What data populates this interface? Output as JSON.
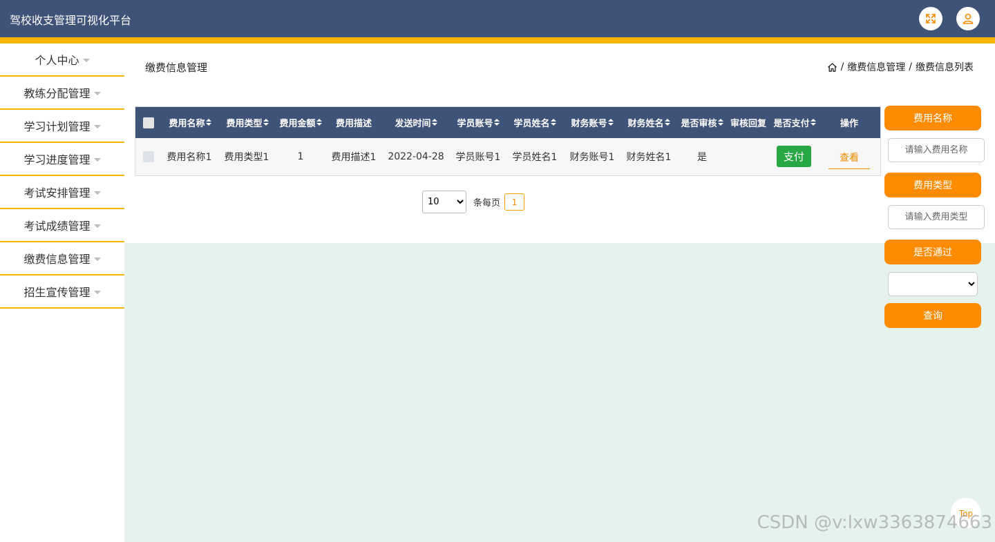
{
  "app": {
    "title": "驾校收支管理可视化平台"
  },
  "header": {
    "fullscreen_icon": "expand-icon",
    "user_icon": "user-icon"
  },
  "sidebar": {
    "items": [
      {
        "label": "个人中心"
      },
      {
        "label": "教练分配管理"
      },
      {
        "label": "学习计划管理"
      },
      {
        "label": "学习进度管理"
      },
      {
        "label": "考试安排管理"
      },
      {
        "label": "考试成绩管理"
      },
      {
        "label": "缴费信息管理"
      },
      {
        "label": "招生宣传管理"
      }
    ]
  },
  "page": {
    "title": "缴费信息管理",
    "breadcrumb": {
      "home_icon": "home-icon",
      "sep": "/",
      "level1": "缴费信息管理",
      "level2": "缴费信息列表"
    }
  },
  "table": {
    "columns": [
      "费用名称",
      "费用类型",
      "费用金额",
      "费用描述",
      "发送时间",
      "学员账号",
      "学员姓名",
      "财务账号",
      "财务姓名",
      "是否审核",
      "审核回复",
      "是否支付",
      "操作"
    ],
    "rows": [
      {
        "name": "费用名称1",
        "type": "费用类型1",
        "amount": "1",
        "desc": "费用描述1",
        "time": "2022-04-28",
        "student_account": "学员账号1",
        "student_name": "学员姓名1",
        "finance_account": "财务账号1",
        "finance_name": "财务姓名1",
        "audited": "是",
        "reply": "",
        "pay_label": "支付",
        "view_label": "查看"
      }
    ]
  },
  "pagination": {
    "page_size": "10",
    "per_page_label": "条每页",
    "current_page": "1"
  },
  "filters": {
    "name_label": "费用名称",
    "name_placeholder": "请输入费用名称",
    "type_label": "费用类型",
    "type_placeholder": "请输入费用类型",
    "pass_label": "是否通过",
    "pass_value": "",
    "search_label": "查询"
  },
  "back_to_top": "Top",
  "watermark": "CSDN @v:lxw3363874663",
  "colors": {
    "header": "#3f5277",
    "accent": "#f7b500",
    "orange": "#ff8c00",
    "success": "#28a745"
  }
}
